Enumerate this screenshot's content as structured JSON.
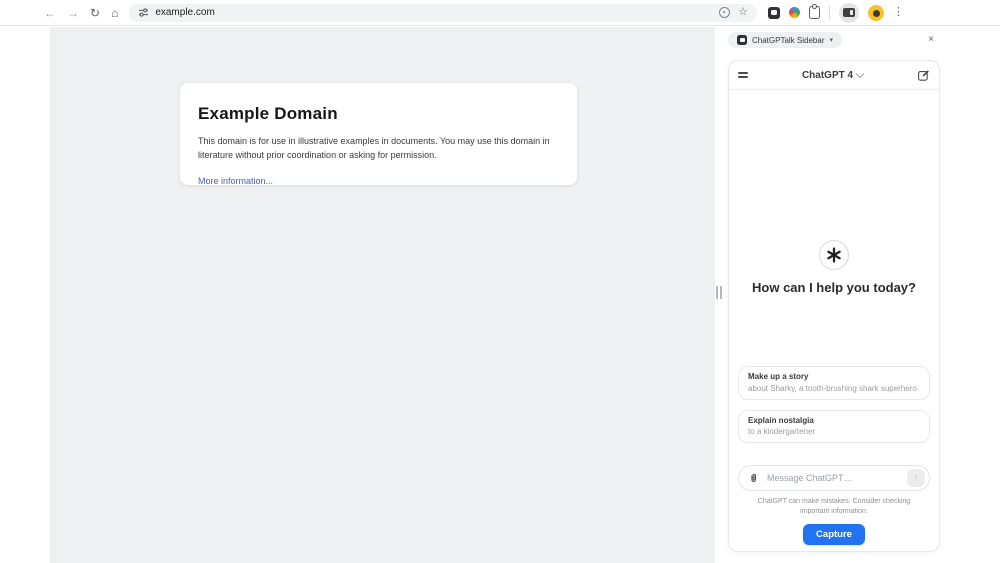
{
  "icons": {
    "back": "←",
    "forward": "→",
    "reload": "↻",
    "home": "⌂",
    "bookmark": "☆",
    "overflow_menu": "⋮",
    "close": "×",
    "send": "↑",
    "caret_down": "▾"
  },
  "browser": {
    "url": "example.com"
  },
  "page": {
    "title": "Example Domain",
    "body": "This domain is for use in illustrative examples in documents. You may use this domain in literature without prior coordination or asking for permission.",
    "link_label": "More information..."
  },
  "sidebar": {
    "extension_label": "ChatGPTalk Sidebar",
    "model_label": "ChatGPT 4",
    "greeting": "How can I help you today?",
    "suggestions": [
      {
        "title": "Make up a story",
        "subtitle": "about Sharky, a tooth-brushing shark superhero"
      },
      {
        "title": "Explain nostalgia",
        "subtitle": "to a kindergartener"
      }
    ],
    "input_placeholder": "Message ChatGPT…",
    "disclaimer": "ChatGPT can make mistakes. Consider checking important information.",
    "capture_label": "Capture"
  },
  "colors": {
    "accent_blue": "#2273f2",
    "page_background": "#eff0f2",
    "omnibox_background": "#f1f3f4",
    "avatar_yellow": "#f7c325"
  }
}
